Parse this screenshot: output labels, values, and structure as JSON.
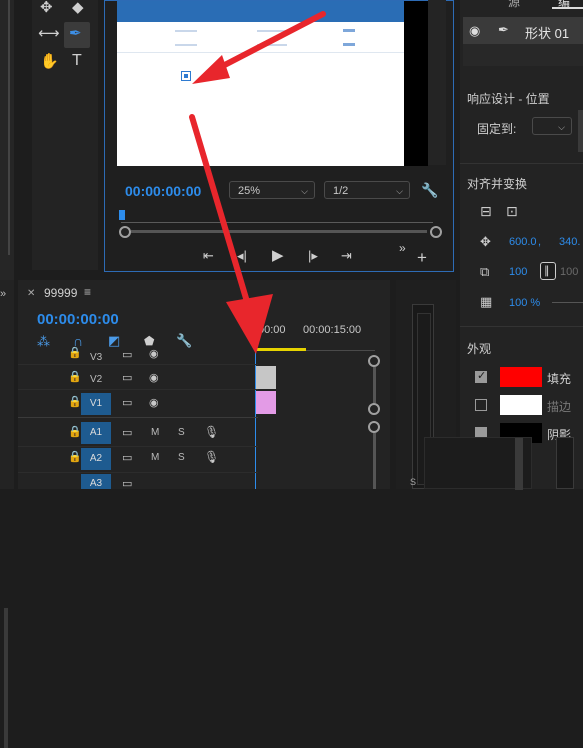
{
  "preview": {
    "timecode": "00:00:00:00",
    "zoom": "25%",
    "resolution": "1/2"
  },
  "timeline": {
    "tab_title": "99999",
    "timecode": "00:00:00:00",
    "ruler_labels": [
      "00:00",
      "00:00:15:00"
    ],
    "tracks": [
      {
        "label": "V3"
      },
      {
        "label": "V2"
      },
      {
        "label": "V1"
      },
      {
        "label": "A1",
        "m": "M",
        "s": "S"
      },
      {
        "label": "A2",
        "m": "M",
        "s": "S"
      },
      {
        "label": "A3"
      }
    ],
    "clip_colors": {
      "v2": "#c6c6c6",
      "v1": "#e39be6"
    }
  },
  "effects": {
    "tab_partial": "源",
    "tab_active_partial": "编",
    "layer_name": "形状 01",
    "responsive_title": "响应设计 - 位置",
    "pin_label": "固定到:",
    "align_title": "对齐并变换",
    "pos_x": "600.0",
    "pos_x_sep": ",",
    "pos_y": "340.",
    "scale_w": "100",
    "scale_h": "100",
    "opacity": "100 %",
    "appearance_title": "外观",
    "fill_label": "填充",
    "fill_color": "#ff0000",
    "stroke_label": "描边",
    "stroke_color": "#ffffff",
    "shadow_label": "阴影"
  },
  "canvas": {
    "selected_square_color": "#2e7bd1"
  },
  "annotations": {
    "arrow_color": "#e8262c"
  }
}
